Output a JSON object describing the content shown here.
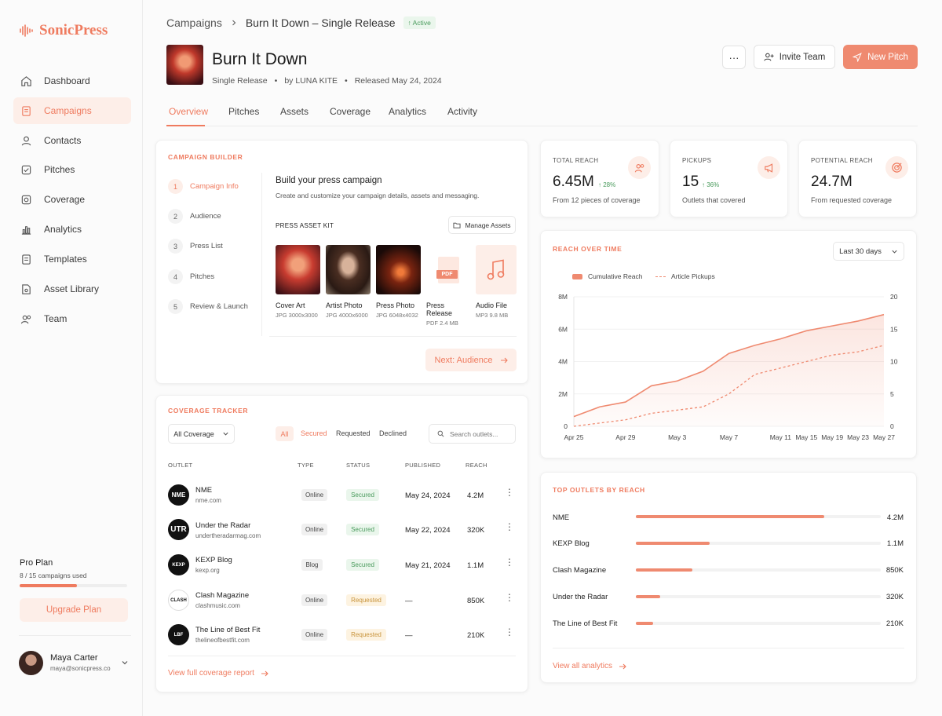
{
  "app": {
    "name": "SonicPress"
  },
  "sidebar": {
    "items": [
      {
        "label": "Dashboard",
        "icon": "home-icon"
      },
      {
        "label": "Campaigns",
        "icon": "campaign-icon",
        "active": true
      },
      {
        "label": "Contacts",
        "icon": "contacts-icon"
      },
      {
        "label": "Pitches",
        "icon": "pitch-icon"
      },
      {
        "label": "Coverage",
        "icon": "coverage-icon"
      },
      {
        "label": "Analytics",
        "icon": "analytics-icon"
      },
      {
        "label": "Templates",
        "icon": "templates-icon"
      },
      {
        "label": "Asset Library",
        "icon": "asset-library-icon"
      },
      {
        "label": "Team",
        "icon": "team-icon"
      }
    ],
    "plan": {
      "title": "Pro Plan",
      "usage": "8 / 15 campaigns used",
      "used_fraction": 0.533,
      "upgrade_label": "Upgrade Plan"
    },
    "user": {
      "name": "Maya Carter",
      "email": "maya@sonicpress.co"
    }
  },
  "header": {
    "breadcrumb": {
      "root": "Campaigns",
      "current": "Burn It Down – Single Release",
      "status": "Active"
    },
    "title": "Burn It Down",
    "meta": {
      "type": "Single Release",
      "artist": "by LUNA KITE",
      "released": "Released May 24, 2024"
    },
    "invite_label": "Invite Team",
    "new_pitch_label": "New Pitch",
    "more_label": "···"
  },
  "tabs": [
    "Overview",
    "Pitches",
    "Assets",
    "Coverage",
    "Analytics",
    "Activity"
  ],
  "builder": {
    "section_title": "CAMPAIGN BUILDER",
    "steps": [
      {
        "num": "1",
        "label": "Campaign Info"
      },
      {
        "num": "2",
        "label": "Audience"
      },
      {
        "num": "3",
        "label": "Press List"
      },
      {
        "num": "4",
        "label": "Pitches"
      },
      {
        "num": "5",
        "label": "Review & Launch"
      }
    ],
    "heading": "Build your press campaign",
    "description": "Create and customize your campaign details, assets and messaging.",
    "kit_title": "PRESS ASSET KIT",
    "manage_label": "Manage Assets",
    "assets": [
      {
        "name": "Cover Art",
        "meta": "JPG 3000x3000"
      },
      {
        "name": "Artist Photo",
        "meta": "JPG 4000x6000"
      },
      {
        "name": "Press Photo",
        "meta": "JPG 6048x4032"
      },
      {
        "name": "Press Release",
        "meta": "PDF 2.4 MB",
        "badge": "PDF"
      },
      {
        "name": "Audio File",
        "meta": "MP3 9.8 MB"
      }
    ],
    "next_label": "Next: Audience"
  },
  "kpis": [
    {
      "label": "TOTAL REACH",
      "value": "6.45M",
      "change": "28%",
      "sub": "From 12 pieces of coverage"
    },
    {
      "label": "PICKUPS",
      "value": "15",
      "change": "36%",
      "sub": "Outlets that covered"
    },
    {
      "label": "POTENTIAL REACH",
      "value": "24.7M",
      "sub": "From requested coverage"
    }
  ],
  "reach_chart": {
    "section_title": "REACH OVER TIME",
    "range_label": "Last 30 days"
  },
  "chart_data": {
    "type": "area",
    "title": "REACH OVER TIME",
    "series": [
      {
        "name": "Cumulative Reach",
        "axis": "left",
        "values": [
          0.6,
          1.2,
          1.5,
          2.5,
          2.8,
          3.4,
          4.5,
          5.0,
          5.4,
          5.9,
          6.2,
          6.5,
          6.9
        ]
      },
      {
        "name": "Article Pickups",
        "axis": "right",
        "values": [
          0,
          0.5,
          1,
          2,
          2.5,
          3,
          5,
          8,
          9,
          10,
          11,
          11.5,
          12.5
        ]
      }
    ],
    "x": [
      "Apr 25",
      "Apr 27",
      "Apr 29",
      "May 1",
      "May 3",
      "May 5",
      "May 7",
      "May 9",
      "May 11",
      "May 15",
      "May 19",
      "May 23",
      "May 27"
    ],
    "x_ticks": [
      "Apr 25",
      "Apr 29",
      "May 3",
      "May 7",
      "May 11",
      "May 15",
      "May 19",
      "May 23",
      "May 27"
    ],
    "y_left_ticks": [
      "0",
      "2M",
      "4M",
      "6M",
      "8M"
    ],
    "y_right_ticks": [
      "0",
      "5",
      "10",
      "15",
      "20"
    ],
    "ylim_left": [
      0,
      8
    ],
    "ylim_right": [
      0,
      20
    ],
    "legend": "top-left"
  },
  "coverage": {
    "section_title": "COVERAGE TRACKER",
    "filter_label": "All Coverage",
    "filters": [
      "All",
      "Secured",
      "Requested",
      "Declined"
    ],
    "search_placeholder": "Search outlets...",
    "columns": [
      "OUTLET",
      "TYPE",
      "STATUS",
      "PUBLISHED",
      "REACH"
    ],
    "rows": [
      {
        "logo": "NME",
        "name": "NME",
        "url": "nme.com",
        "type": "Online",
        "status": "Secured",
        "published": "May 24, 2024",
        "reach": "4.2M"
      },
      {
        "logo": "UTR",
        "name": "Under the Radar",
        "url": "undertheradarmag.com",
        "type": "Online",
        "status": "Secured",
        "published": "May 22, 2024",
        "reach": "320K"
      },
      {
        "logo": "KEXP",
        "name": "KEXP Blog",
        "url": "kexp.org",
        "type": "Blog",
        "status": "Secured",
        "published": "May 21, 2024",
        "reach": "1.1M"
      },
      {
        "logo": "CLASH",
        "name": "Clash Magazine",
        "url": "clashmusic.com",
        "type": "Online",
        "status": "Requested",
        "published": "—",
        "reach": "850K"
      },
      {
        "logo": "LBF",
        "name": "The Line of Best Fit",
        "url": "thelineofbestfit.com",
        "type": "Online",
        "status": "Requested",
        "published": "—",
        "reach": "210K"
      }
    ],
    "view_report_label": "View full coverage report"
  },
  "top_outlets": {
    "section_title": "TOP OUTLETS BY REACH",
    "items": [
      {
        "name": "NME",
        "value": "4.2M",
        "fraction": 0.77
      },
      {
        "name": "KEXP Blog",
        "value": "1.1M",
        "fraction": 0.3
      },
      {
        "name": "Clash Magazine",
        "value": "850K",
        "fraction": 0.23
      },
      {
        "name": "Under the Radar",
        "value": "320K",
        "fraction": 0.1
      },
      {
        "name": "The Line of Best Fit",
        "value": "210K",
        "fraction": 0.07
      }
    ],
    "view_all_label": "View all analytics"
  },
  "colors": {
    "accent": "#ef7b5f",
    "success": "#4a9b5d",
    "warning": "#c8933a"
  }
}
